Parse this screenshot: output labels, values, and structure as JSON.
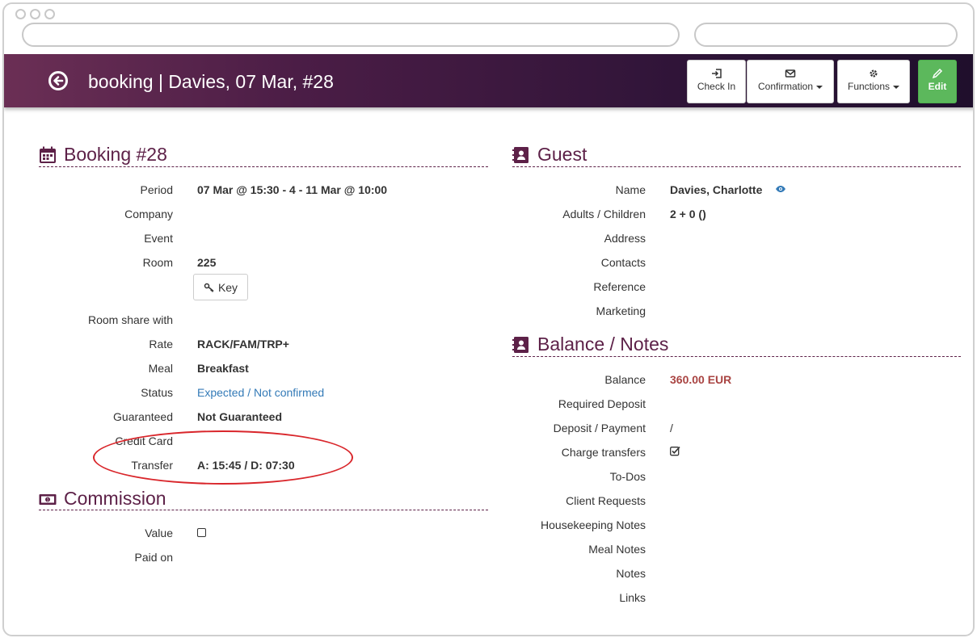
{
  "header": {
    "title": "booking | Davies, 07 Mar, #28",
    "buttons": {
      "check_in": "Check In",
      "confirmation": "Confirmation",
      "functions": "Functions",
      "edit": "Edit"
    }
  },
  "booking": {
    "title": "Booking #28",
    "rows": [
      {
        "label": "Period",
        "value": "07 Mar @ 15:30 - 4 - 11 Mar @ 10:00"
      },
      {
        "label": "Company",
        "value": ""
      },
      {
        "label": "Event",
        "value": ""
      },
      {
        "label": "Room",
        "value": "225"
      },
      {
        "label": "Room share with",
        "value": ""
      },
      {
        "label": "Rate",
        "value": "RACK/FAM/TRP+"
      },
      {
        "label": "Meal",
        "value": "Breakfast"
      },
      {
        "label": "Status",
        "value": "Expected / Not confirmed"
      },
      {
        "label": "Guaranteed",
        "value": "Not Guaranteed"
      },
      {
        "label": "Credit Card",
        "value": ""
      },
      {
        "label": "Transfer",
        "value": "A: 15:45 / D: 07:30"
      }
    ],
    "key_button": "Key"
  },
  "commission": {
    "title": "Commission",
    "rows": [
      {
        "label": "Value"
      },
      {
        "label": "Paid on",
        "value": ""
      }
    ]
  },
  "guest": {
    "title": "Guest",
    "rows": [
      {
        "label": "Name",
        "value": "Davies, Charlotte"
      },
      {
        "label": "Adults / Children",
        "value": "2 + 0 ()"
      },
      {
        "label": "Address",
        "value": ""
      },
      {
        "label": "Contacts",
        "value": ""
      },
      {
        "label": "Reference",
        "value": ""
      },
      {
        "label": "Marketing",
        "value": ""
      }
    ]
  },
  "balance": {
    "title": "Balance / Notes",
    "rows": [
      {
        "label": "Balance",
        "value": "360.00 EUR"
      },
      {
        "label": "Required Deposit",
        "value": ""
      },
      {
        "label": "Deposit / Payment",
        "value": "/"
      },
      {
        "label": "Charge transfers",
        "checked": true
      },
      {
        "label": "To-Dos",
        "value": ""
      },
      {
        "label": "Client Requests",
        "value": ""
      },
      {
        "label": "Housekeeping Notes",
        "value": ""
      },
      {
        "label": "Meal Notes",
        "value": ""
      },
      {
        "label": "Notes",
        "value": ""
      },
      {
        "label": "Links",
        "value": ""
      }
    ]
  },
  "colors": {
    "brand": "#5d2148",
    "edit_green": "#5cb85c",
    "link_blue": "#337ab7",
    "balance_red": "#a94442",
    "highlight_ellipse": "#d9262b"
  }
}
